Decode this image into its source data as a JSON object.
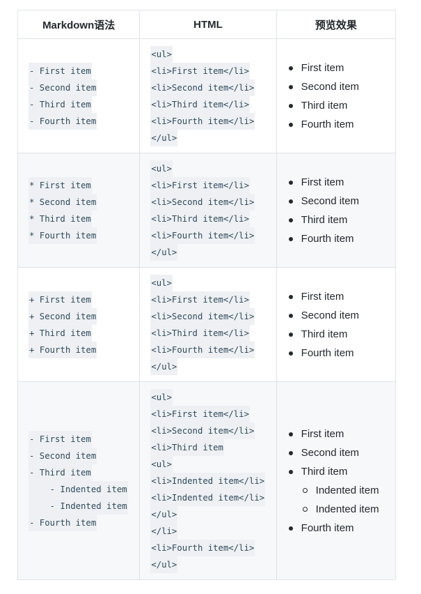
{
  "table": {
    "headers": [
      "Markdown语法",
      "HTML",
      "预览效果"
    ],
    "rows": [
      {
        "markdown": [
          "- First item",
          "- Second item",
          "- Third item",
          "- Fourth item"
        ],
        "html": [
          "<ul>",
          "<li>First item</li>",
          "<li>Second item</li>",
          "<li>Third item</li>",
          "<li>Fourth item</li>",
          "</ul>"
        ],
        "preview": [
          "First item",
          "Second item",
          "Third item",
          "Fourth item"
        ]
      },
      {
        "markdown": [
          "* First item",
          "* Second item",
          "* Third item",
          "* Fourth item"
        ],
        "html": [
          "<ul>",
          "<li>First item</li>",
          "<li>Second item</li>",
          "<li>Third item</li>",
          "<li>Fourth item</li>",
          "</ul>"
        ],
        "preview": [
          "First item",
          "Second item",
          "Third item",
          "Fourth item"
        ]
      },
      {
        "markdown": [
          "+ First item",
          "+ Second item",
          "+ Third item",
          "+ Fourth item"
        ],
        "html": [
          "<ul>",
          "<li>First item</li>",
          "<li>Second item</li>",
          "<li>Third item</li>",
          "<li>Fourth item</li>",
          "</ul>"
        ],
        "preview": [
          "First item",
          "Second item",
          "Third item",
          "Fourth item"
        ]
      },
      {
        "markdown": [
          "- First item",
          "- Second item",
          "- Third item",
          "    - Indented item",
          "    - Indented item",
          "- Fourth item"
        ],
        "html": [
          "<ul>",
          "<li>First item</li>",
          "<li>Second item</li>",
          "<li>Third item",
          "<ul>",
          "<li>Indented item</li>",
          "<li>Indented item</li>",
          "</ul>",
          "</li>",
          "<li>Fourth item</li>",
          "</ul>"
        ],
        "preview": [
          "First item",
          "Second item",
          "Third item",
          "Fourth item"
        ],
        "preview_nested": [
          "Indented item",
          "Indented item"
        ]
      }
    ]
  }
}
